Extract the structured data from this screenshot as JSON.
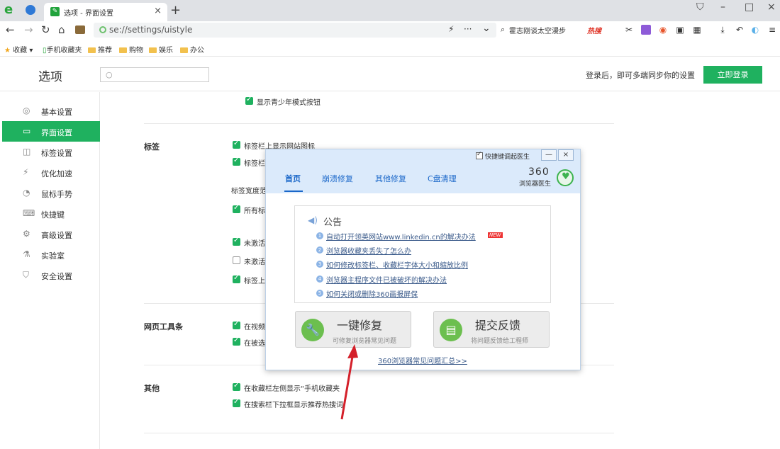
{
  "tab": {
    "title": "选项 - 界面设置",
    "close": "×",
    "new": "+"
  },
  "window": {
    "restore": "□",
    "min": "–",
    "close": "×",
    "skin": "⛉"
  },
  "toolbar": {
    "url": "se://settings/uistyle",
    "search_query": "霍志刚谈太空漫步",
    "search_hot": "热搜",
    "more": "···",
    "dropdown": "⌄"
  },
  "bookmarks": {
    "label": "收藏",
    "items": [
      "手机收藏夹",
      "推荐",
      "购物",
      "娱乐",
      "办公"
    ]
  },
  "header": {
    "title": "选项",
    "search_placeholder": "",
    "sync_text": "登录后，即可多端同步你的设置",
    "login_label": "立即登录"
  },
  "sidebar": {
    "items": [
      {
        "label": "基本设置",
        "icon": "◎"
      },
      {
        "label": "界面设置",
        "icon": "▭",
        "active": true
      },
      {
        "label": "标签设置",
        "icon": "◫"
      },
      {
        "label": "优化加速",
        "icon": "⚡"
      },
      {
        "label": "鼠标手势",
        "icon": "◔"
      },
      {
        "label": "快捷键",
        "icon": "⌨"
      },
      {
        "label": "高级设置",
        "icon": "⚙"
      },
      {
        "label": "实验室",
        "icon": "⚗"
      },
      {
        "label": "安全设置",
        "icon": "⛉"
      }
    ]
  },
  "content": {
    "top_option": "显示青少年模式按钮",
    "sections": {
      "tabs": {
        "title": "标签",
        "opt1": "标签栏上显示网站图标",
        "opt2": "标签栏",
        "width_label": "标签宽度范",
        "opt3": "所有标",
        "opt4": "未激活",
        "opt5": "未激活",
        "opt6": "标签上"
      },
      "webtoolbar": {
        "title": "网页工具条",
        "opt1": "在视频",
        "opt2": "在被选"
      },
      "other": {
        "title": "其他",
        "opt1": "在收藏栏左侧显示“手机收藏夹",
        "opt2": "在搜索栏下拉框显示推荐热搜词"
      }
    }
  },
  "dialog": {
    "quick_label": "快捷键调起医生",
    "min": "—",
    "close": "×",
    "tabs": [
      "首页",
      "崩溃修复",
      "其他修复",
      "C盘清理"
    ],
    "brand": "360",
    "brand_sub": "浏览器医生",
    "notice_title": "公告",
    "new_badge": "NEW",
    "notices": [
      {
        "num": "1",
        "text": "自动打开领英网站www.linkedin.cn的解决办法"
      },
      {
        "num": "2",
        "text": "浏览器收藏夹丢失了怎么办"
      },
      {
        "num": "3",
        "text": "如何修改标签栏、收藏栏字体大小和缩放比例"
      },
      {
        "num": "4",
        "text": "浏览器主程序文件已被破坏的解决办法"
      },
      {
        "num": "5",
        "text": "如何关闭或删除360画报屏保"
      }
    ],
    "repair": {
      "title": "一键修复",
      "sub": "可修复浏览器常见问题"
    },
    "feedback": {
      "title": "提交反馈",
      "sub": "将问题反馈给工程师"
    },
    "faq": "360浏览器常见问题汇总>>"
  }
}
